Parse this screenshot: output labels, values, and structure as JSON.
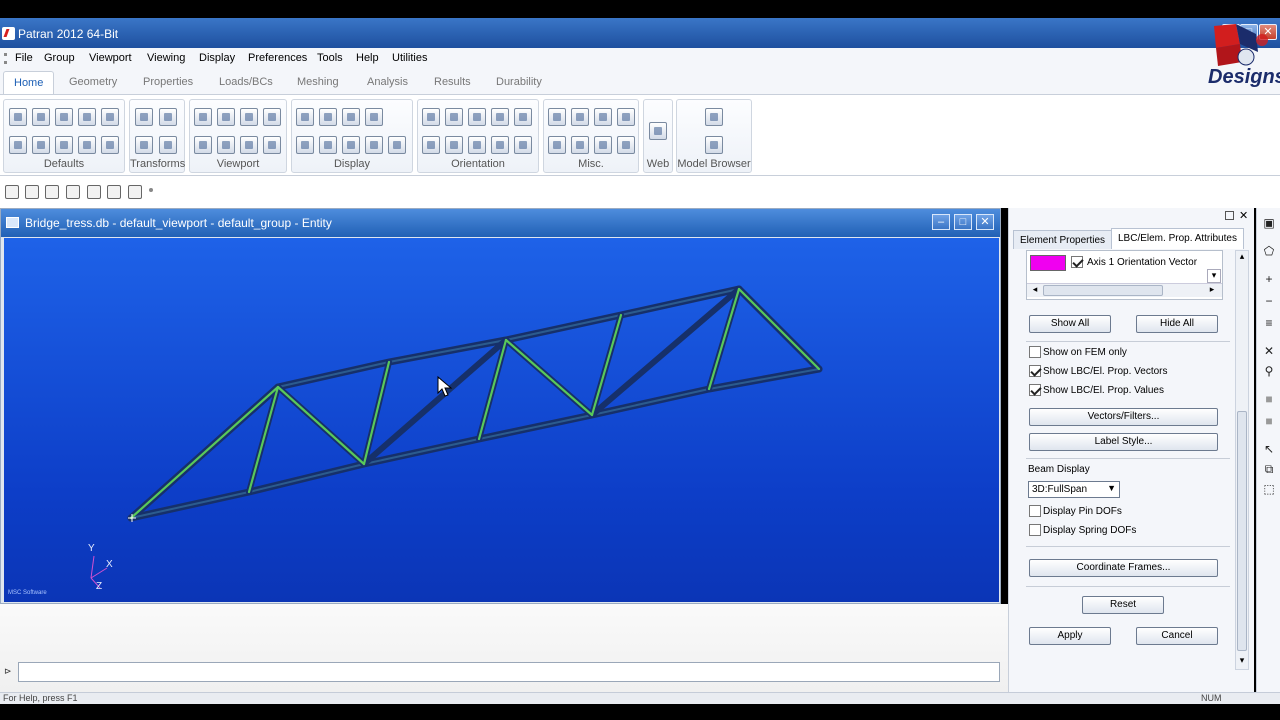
{
  "window": {
    "title": "Patran 2012 64-Bit",
    "controls": [
      "–",
      "□",
      "✕"
    ]
  },
  "menubar": [
    "File",
    "Group",
    "Viewport",
    "Viewing",
    "Display",
    "Preferences",
    "Tools",
    "Help",
    "Utilities"
  ],
  "tabs": [
    {
      "label": "Home",
      "active": true
    },
    {
      "label": "Geometry"
    },
    {
      "label": "Properties"
    },
    {
      "label": "Loads/BCs"
    },
    {
      "label": "Meshing"
    },
    {
      "label": "Analysis"
    },
    {
      "label": "Results"
    },
    {
      "label": "Durability"
    }
  ],
  "ribbon_groups": [
    "Defaults",
    "Transforms",
    "Viewport",
    "Display",
    "Orientation",
    "Misc.",
    "Web",
    "Model Browser"
  ],
  "viewport": {
    "title": "Bridge_tress.db - default_viewport - default_group - Entity",
    "axes": {
      "y": "Y",
      "x": "X",
      "z": "Z"
    },
    "watermark": "MSC Software",
    "colors": {
      "background": "#1450d8",
      "chord": "#16306a",
      "diagonal": "#59c95a"
    }
  },
  "panel": {
    "tabs": [
      "Element Properties",
      "LBC/Elem. Prop. Attributes"
    ],
    "active_tab": "LBC/Elem. Prop. Attributes",
    "attribute_list": [
      {
        "swatch_color": "#f000f0",
        "checked": true,
        "label": "Axis 1 Orientation Vector"
      }
    ],
    "show_all": "Show All",
    "hide_all": "Hide All",
    "checks": [
      {
        "label": "Show on FEM only",
        "checked": false
      },
      {
        "label": "Show LBC/El. Prop. Vectors",
        "checked": true
      },
      {
        "label": "Show LBC/El. Prop. Values",
        "checked": true
      }
    ],
    "vectors_filters": "Vectors/Filters...",
    "label_style": "Label Style...",
    "beam_display_label": "Beam Display",
    "beam_display_value": "3D:FullSpan",
    "beam_checks": [
      {
        "label": "Display Pin DOFs",
        "checked": false
      },
      {
        "label": "Display Spring DOFs",
        "checked": false
      }
    ],
    "coordinate_frames": "Coordinate Frames...",
    "reset": "Reset",
    "apply": "Apply",
    "cancel": "Cancel"
  },
  "command_prompt": "⊳",
  "status": {
    "help": "For Help, press F1",
    "num": "NUM"
  },
  "logo": {
    "text": "Designs"
  }
}
